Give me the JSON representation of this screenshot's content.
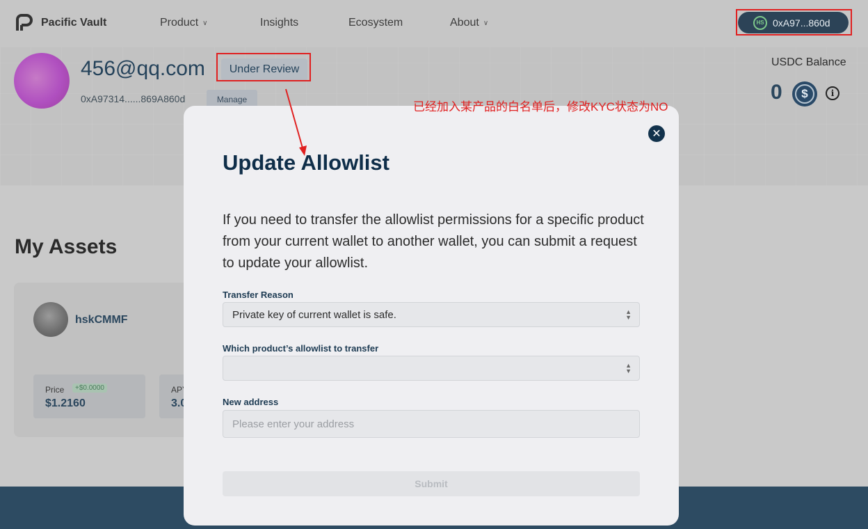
{
  "nav": {
    "brand": "Pacific Vault",
    "links": [
      {
        "label": "Product",
        "has_dropdown": true
      },
      {
        "label": "Insights",
        "has_dropdown": false
      },
      {
        "label": "Ecosystem",
        "has_dropdown": false
      },
      {
        "label": "About",
        "has_dropdown": true
      }
    ],
    "wallet_badge": "HS",
    "wallet_address": "0xA97...860d"
  },
  "profile": {
    "email": "456@qq.com",
    "status": "Under Review",
    "address": "0xA97314......869A860d",
    "manage_label": "Manage"
  },
  "balance": {
    "label": "USDC Balance",
    "value": "0",
    "currency_symbol": "$",
    "info_symbol": "i"
  },
  "annotation": "已经加入某产品的白名单后，修改KYC状态为NO",
  "assets": {
    "title": "My Assets",
    "card": {
      "name": "hskCMMF",
      "price_label": "Price",
      "price_change": "+$0.0000",
      "price_value": "$1.2160",
      "apy_label": "APY",
      "apy_value": "3.0"
    }
  },
  "modal": {
    "title": "Update Allowlist",
    "description": "If you need to transfer the allowlist permissions for a specific product from your current wallet to another wallet, you can submit a request to update your allowlist.",
    "close_symbol": "✕",
    "transfer_reason_label": "Transfer Reason",
    "transfer_reason_value": "Private key of current wallet is safe.",
    "product_label": "Which product’s allowlist to transfer",
    "product_value": "",
    "address_label": "New address",
    "address_placeholder": "Please enter your address",
    "submit_label": "Submit"
  },
  "colors": {
    "highlight": "#e02020",
    "navy": "#0f2e49",
    "footer": "#2d4b62"
  }
}
